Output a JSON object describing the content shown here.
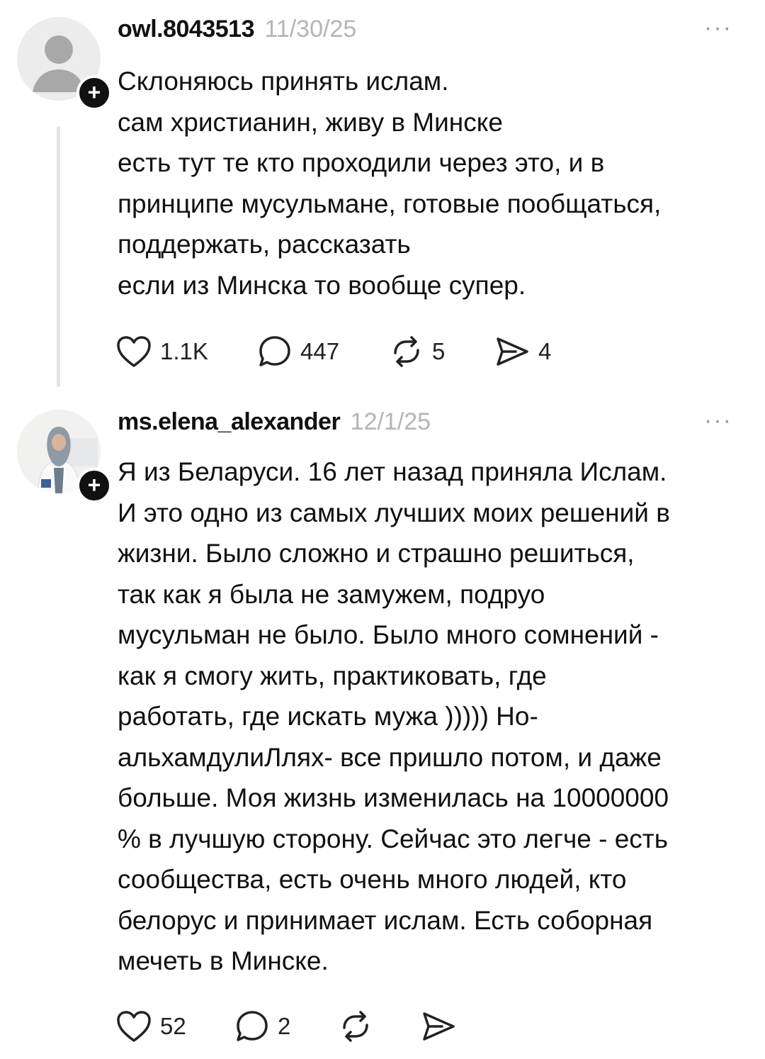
{
  "posts": [
    {
      "username": "owl.8043513",
      "date": "11/30/25",
      "more_icon": "ellipsis-icon",
      "text": "Склоняюсь принять ислам.\nсам христианин, живу в Минске\nесть тут те кто  проходили через это,  и в\nпринципе мусульмане, готовые пообщаться,\nподдержать, рассказать\nесли из Минска то вообще супер.",
      "likes": "1.1K",
      "replies": "447",
      "reposts": "5",
      "shares": "4"
    },
    {
      "username": "ms.elena_alexander",
      "date": "12/1/25",
      "more_icon": "ellipsis-icon",
      "text": "Я из Беларуси. 16 лет назад приняла Ислам.\nИ это одно из самых лучших моих решений в\nжизни. Было сложно и страшно решиться,\nтак как я была не замужем, подруо\nмусульман не было. Было много сомнений -\nкак я смогу жить, практиковать, где\nработать, где искать мужа ))))) Но-\nальхамдулиЛлях- все пришло потом, и даже\nбольше. Моя жизнь изменилась на 10000000\n% в лучшую сторону. Сейчас это легче - есть\nсообщества, есть очень много людей, кто\nбелорус и принимает ислам. Есть соборная\nмечеть в Минске.",
      "likes": "52",
      "replies": "2"
    }
  ],
  "ui": {
    "more": "···",
    "plus": "+"
  },
  "colors": {
    "text": "#111111",
    "muted": "#b5b5b5",
    "thread": "#e3e3e3",
    "badge": "#111111"
  }
}
